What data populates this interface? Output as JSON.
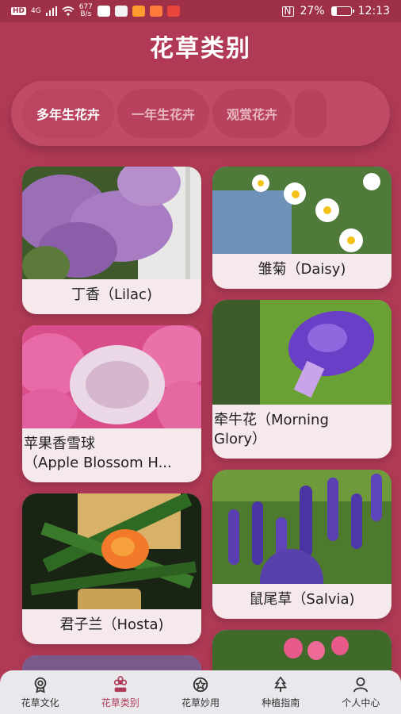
{
  "status": {
    "network_badge": "HD",
    "signal_text": "4G",
    "net_speed_value": "677",
    "net_speed_unit": "B/s",
    "battery_percent_text": "27%",
    "battery_level": 0.27,
    "time": "12:13"
  },
  "header": {
    "title": "花草类别"
  },
  "tabs": [
    {
      "label": "多年生花卉",
      "active": true
    },
    {
      "label": "一年生花卉",
      "active": false
    },
    {
      "label": "观赏花卉",
      "active": false
    }
  ],
  "cards": [
    {
      "label": "丁香（Lilac)"
    },
    {
      "label": "雏菊（Daisy)"
    },
    {
      "label_line1": "苹果香雪球",
      "label_line2": "（Apple Blossom H..."
    },
    {
      "label_line1": "牵牛花（Morning",
      "label_line2": "Glory）"
    },
    {
      "label": "君子兰（Hosta)"
    },
    {
      "label": "鼠尾草（Salvia)"
    }
  ],
  "bottom_nav": [
    {
      "label": "花草文化",
      "icon": "badge-icon",
      "active": false
    },
    {
      "label": "花草类别",
      "icon": "flower-icon",
      "active": true
    },
    {
      "label": "花草妙用",
      "icon": "star-badge-icon",
      "active": false
    },
    {
      "label": "种植指南",
      "icon": "tree-icon",
      "active": false
    },
    {
      "label": "个人中心",
      "icon": "person-icon",
      "active": false
    }
  ],
  "colors": {
    "background": "#b03a56",
    "accent": "#b03a56",
    "card": "#f6e9ec"
  }
}
